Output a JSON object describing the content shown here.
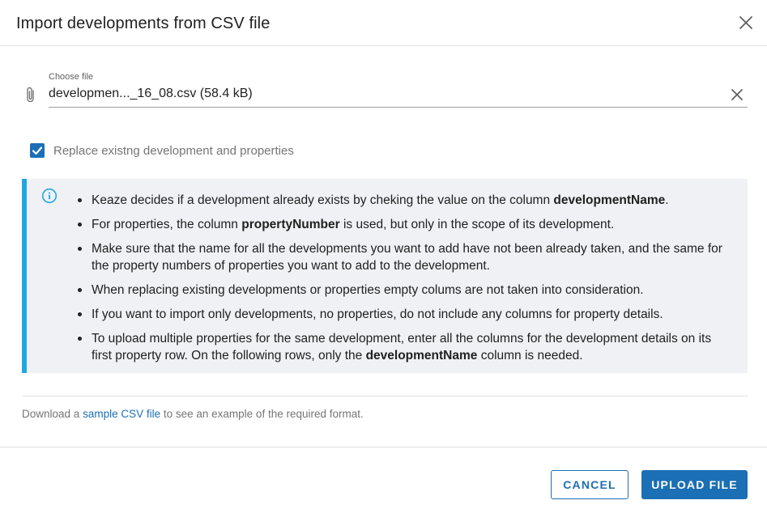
{
  "dialog": {
    "title": "Import developments from CSV file",
    "close_icon": "close-icon"
  },
  "file_input": {
    "label": "Choose file",
    "value": "developmen..._16_08.csv (58.4 kB)",
    "attach_icon": "paperclip-icon",
    "clear_icon": "close-icon"
  },
  "replace_option": {
    "label": "Replace existng development and properties",
    "checked": true
  },
  "info": {
    "icon": "info-icon",
    "items": [
      {
        "pre": "Keaze decides if a development already exists by cheking the value on the column ",
        "bold": "developmentName",
        "post": "."
      },
      {
        "pre": "For properties, the column ",
        "bold": "propertyNumber",
        "post": " is used, but only in the scope of its development."
      },
      {
        "pre": "Make sure that the name for all the developments you want to add have not been already taken, and the same for the property numbers of properties you want to add to the development.",
        "bold": "",
        "post": ""
      },
      {
        "pre": "When replacing existing developments or properties empty colums are not taken into consideration.",
        "bold": "",
        "post": ""
      },
      {
        "pre": "If you want to import only developments, no properties, do not include any columns for property details.",
        "bold": "",
        "post": ""
      },
      {
        "pre": "To upload multiple properties for the same development, enter all the columns for the development details on its first property row. On the following rows, only the ",
        "bold": "developmentName",
        "post": " column is needed."
      }
    ]
  },
  "download": {
    "prefix": "Download a ",
    "link": "sample CSV file",
    "suffix": " to see an example of the required format."
  },
  "actions": {
    "cancel": "CANCEL",
    "upload": "UPLOAD FILE"
  },
  "colors": {
    "accent": "#1b6fb5",
    "info_border": "#1fa8e0",
    "info_bg": "#f0f1f5"
  }
}
